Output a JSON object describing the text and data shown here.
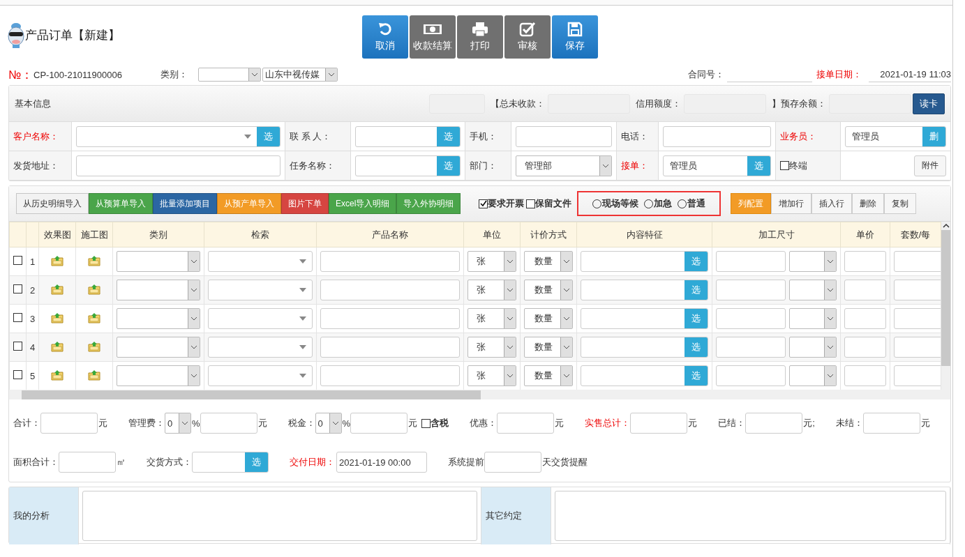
{
  "window": {
    "title": "产品订单【新建】"
  },
  "actions": [
    {
      "label": "取消",
      "kind": "primary"
    },
    {
      "label": "收款结算",
      "kind": "default"
    },
    {
      "label": "打印",
      "kind": "default"
    },
    {
      "label": "审核",
      "kind": "default"
    },
    {
      "label": "保存",
      "kind": "primary"
    }
  ],
  "order": {
    "no_label": "№：",
    "number": "CP-100-21011900006",
    "category_label": "类别：",
    "company": "山东中视传媒",
    "contract_label": "合同号：",
    "date_label": "接单日期：",
    "date": "2021-01-19 11:03"
  },
  "basic_info": {
    "title": "基本信息",
    "balances": [
      "【总未收款：",
      "信用额度：",
      "】预存余额："
    ],
    "read_card": "读卡",
    "rows": [
      [
        {
          "label": "客户名称：",
          "required": true,
          "kind": "combo",
          "button": "选"
        },
        {
          "label": "联 系 人：",
          "required": false,
          "kind": "pick",
          "button": "选"
        },
        {
          "label": "手机：",
          "required": false,
          "kind": "text"
        },
        {
          "label": "电话：",
          "required": false,
          "kind": "text"
        },
        {
          "label": "业务员：",
          "required": true,
          "kind": "pick",
          "value": "管理员",
          "button": "删"
        }
      ],
      [
        {
          "label": "发货地址：",
          "required": false,
          "kind": "text"
        },
        {
          "label": "任务名称：",
          "required": false,
          "kind": "pick",
          "button": "选"
        },
        {
          "label": "部门：",
          "required": false,
          "kind": "select",
          "value": "管理部"
        },
        {
          "label": "接单：",
          "required": true,
          "kind": "pick",
          "value": "管理员",
          "button": "选"
        },
        {
          "label": "终端",
          "kind": "checkbox",
          "checked": false,
          "button": "附件"
        }
      ]
    ]
  },
  "toolbar": {
    "imports": [
      {
        "label": "从历史明细导入",
        "color": "#f2f2f2"
      },
      {
        "label": "从预算单导入",
        "color": "#4aa54a"
      },
      {
        "label": "批量添加项目",
        "color": "#2b66a3"
      },
      {
        "label": "从预产单导入",
        "color": "#f29b26"
      },
      {
        "label": "图片下单",
        "color": "#d64541"
      },
      {
        "label": "Excel导入明细",
        "color": "#4aa54a"
      },
      {
        "label": "导入外协明细",
        "color": "#4aa54a"
      }
    ],
    "options": [
      {
        "label": "要求开票",
        "checked": true
      },
      {
        "label": "保留文件",
        "checked": false
      }
    ],
    "priority": [
      {
        "label": "现场等候",
        "selected": false
      },
      {
        "label": "加急",
        "selected": false
      },
      {
        "label": "普通",
        "selected": false
      }
    ],
    "row_tools": [
      {
        "label": "列配置",
        "selected": true
      },
      {
        "label": "增加行",
        "selected": false
      },
      {
        "label": "插入行",
        "selected": false
      },
      {
        "label": "删除",
        "selected": false
      },
      {
        "label": "复制",
        "selected": false
      }
    ]
  },
  "table": {
    "columns": [
      "效果图",
      "施工图",
      "类别",
      "检索",
      "产品名称",
      "单位",
      "计价方式",
      "内容特征",
      "加工尺寸",
      "单价",
      "套数/每"
    ],
    "rows": [
      {
        "no": "1",
        "checked": false,
        "unit": "张",
        "pricing": "数量",
        "pick": "选"
      },
      {
        "no": "2",
        "checked": false,
        "unit": "张",
        "pricing": "数量",
        "pick": "选"
      },
      {
        "no": "3",
        "checked": false,
        "unit": "张",
        "pricing": "数量",
        "pick": "选"
      },
      {
        "no": "4",
        "checked": false,
        "unit": "张",
        "pricing": "数量",
        "pick": "选"
      },
      {
        "no": "5",
        "checked": false,
        "unit": "张",
        "pricing": "数量",
        "pick": "选"
      }
    ]
  },
  "totals": [
    [
      {
        "kind": "label",
        "text": "合计：",
        "required": false
      },
      {
        "kind": "input"
      },
      {
        "kind": "unit",
        "text": "元"
      },
      {
        "kind": "label",
        "text": "管理费：",
        "required": false
      },
      {
        "kind": "percent",
        "value": "0",
        "unit": "%"
      },
      {
        "kind": "input"
      },
      {
        "kind": "unit",
        "text": "元"
      },
      {
        "kind": "label",
        "text": "税金：",
        "required": false
      },
      {
        "kind": "percent",
        "value": "0",
        "unit": "%"
      },
      {
        "kind": "input"
      },
      {
        "kind": "unit",
        "text": "元"
      },
      {
        "kind": "check",
        "text": "含税",
        "checked": false
      },
      {
        "kind": "label",
        "text": "优惠：",
        "required": false
      },
      {
        "kind": "input"
      },
      {
        "kind": "unit",
        "text": "元"
      },
      {
        "kind": "label",
        "text": "实售总计：",
        "required": true
      },
      {
        "kind": "input"
      },
      {
        "kind": "unit",
        "text": "元"
      },
      {
        "kind": "label",
        "text": "已结：",
        "required": false
      },
      {
        "kind": "input"
      },
      {
        "kind": "unit",
        "text": "元;"
      },
      {
        "kind": "label",
        "text": "未结：",
        "required": false
      },
      {
        "kind": "input"
      },
      {
        "kind": "unit",
        "text": "元"
      }
    ],
    [
      {
        "kind": "label",
        "text": "面积合计：",
        "required": false
      },
      {
        "kind": "input"
      },
      {
        "kind": "unit",
        "text": "㎡"
      },
      {
        "kind": "label",
        "text": "交货方式：",
        "required": false
      },
      {
        "kind": "pick",
        "button": "选"
      },
      {
        "kind": "label",
        "text": "交付日期：",
        "required": true
      },
      {
        "kind": "input",
        "value": "2021-01-19 00:00"
      },
      {
        "kind": "label",
        "text": "系统提前",
        "required": false
      },
      {
        "kind": "input"
      },
      {
        "kind": "unit",
        "text": "天交货提醒"
      }
    ]
  ],
  "notes": [
    {
      "label": "我的分析"
    },
    {
      "label": "其它约定"
    }
  ]
}
